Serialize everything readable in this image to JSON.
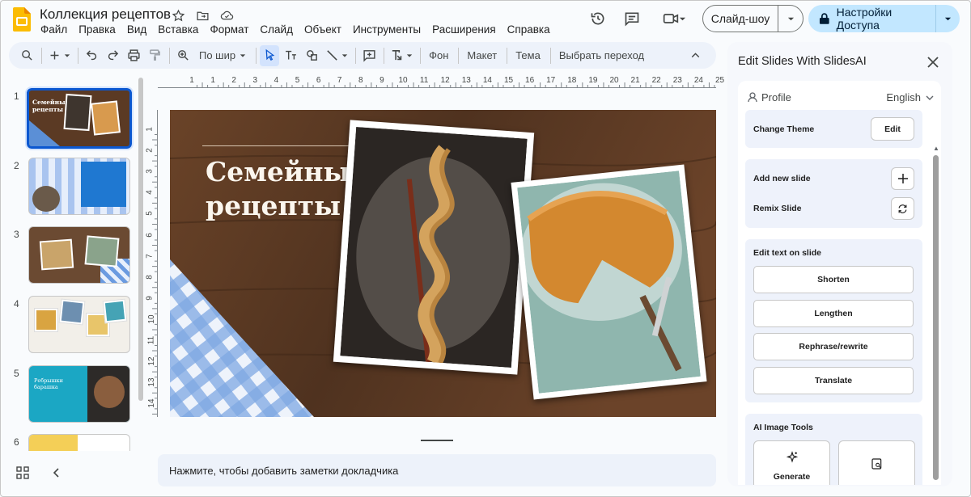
{
  "app": {
    "title": "Коллекция рецептов",
    "menu": [
      "Файл",
      "Правка",
      "Вид",
      "Вставка",
      "Формат",
      "Слайд",
      "Объект",
      "Инструменты",
      "Расширения",
      "Справка"
    ]
  },
  "header": {
    "slideshow_label": "Слайд-шоу",
    "share_label": "Настройки Доступа"
  },
  "toolbar": {
    "zoom_label": "По шир",
    "background_label": "Фон",
    "layout_label": "Макет",
    "theme_label": "Тема",
    "transition_label": "Выбрать переход"
  },
  "ruler": {
    "h_ticks": [
      "1",
      "1",
      "2",
      "3",
      "4",
      "5",
      "6",
      "7",
      "8",
      "9",
      "10",
      "11",
      "12",
      "13",
      "14",
      "15",
      "16",
      "17",
      "18",
      "19",
      "20",
      "21",
      "22",
      "23",
      "24",
      "25"
    ],
    "v_ticks": [
      "1",
      "2",
      "3",
      "4",
      "5",
      "6",
      "7",
      "8",
      "9",
      "10",
      "11",
      "12",
      "13",
      "14"
    ]
  },
  "filmstrip": {
    "slides": [
      {
        "num": "1",
        "selected": true
      },
      {
        "num": "2",
        "selected": false
      },
      {
        "num": "3",
        "selected": false
      },
      {
        "num": "4",
        "selected": false
      },
      {
        "num": "5",
        "selected": false
      },
      {
        "num": "6",
        "selected": false
      }
    ],
    "thumb1_title": "Семейные рецепты",
    "thumb5_title": "Ребрышки барашка"
  },
  "slide": {
    "title": "Семейные\nрецепты"
  },
  "notes": {
    "placeholder": "Нажмите, чтобы добавить заметки докладчика"
  },
  "panel": {
    "title": "Edit Slides With SlidesAI",
    "profile_label": "Profile",
    "language": "English",
    "change_theme_label": "Change Theme",
    "edit_button": "Edit",
    "add_slide_label": "Add new slide",
    "remix_label": "Remix Slide",
    "edit_text_label": "Edit text on slide",
    "shorten": "Shorten",
    "lengthen": "Lengthen",
    "rephrase": "Rephrase/rewrite",
    "translate": "Translate",
    "ai_image_label": "AI Image Tools",
    "generate": "Generate"
  },
  "colors": {
    "accent": "#0b57d0",
    "share_bg": "#c2e7ff",
    "toolbar_bg": "#edf2fa",
    "slide_wood": "#5b3a24",
    "logo": "#fbbc04"
  }
}
